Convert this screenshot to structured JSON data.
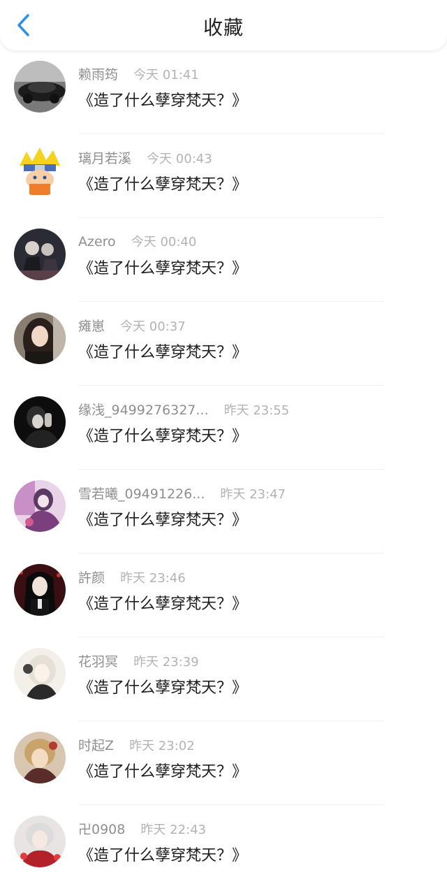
{
  "header": {
    "title": "收藏"
  },
  "colors": {
    "accent": "#2f8fe8"
  },
  "items": [
    {
      "name": "赖雨筠",
      "time": "今天 01:41",
      "content": "《造了什么孽穿梵天？》"
    },
    {
      "name": "璃月若溪",
      "time": "今天 00:43",
      "content": "《造了什么孽穿梵天？》"
    },
    {
      "name": "Azero",
      "time": "今天 00:40",
      "content": "《造了什么孽穿梵天？》"
    },
    {
      "name": "瘫崽",
      "time": "今天 00:37",
      "content": "《造了什么孽穿梵天？》"
    },
    {
      "name": "缘浅_9499276327...",
      "time": "昨天 23:55",
      "content": "《造了什么孽穿梵天？》"
    },
    {
      "name": "雪若曦_09491226...",
      "time": "昨天 23:47",
      "content": "《造了什么孽穿梵天？》"
    },
    {
      "name": "許颜",
      "time": "昨天 23:46",
      "content": "《造了什么孽穿梵天？》"
    },
    {
      "name": "花羽冥",
      "time": "昨天 23:39",
      "content": "《造了什么孽穿梵天？》"
    },
    {
      "name": "时起Z",
      "time": "昨天 23:02",
      "content": "《造了什么孽穿梵天？》"
    },
    {
      "name": "卍0908",
      "time": "昨天 22:43",
      "content": "《造了什么孽穿梵天？》"
    }
  ]
}
